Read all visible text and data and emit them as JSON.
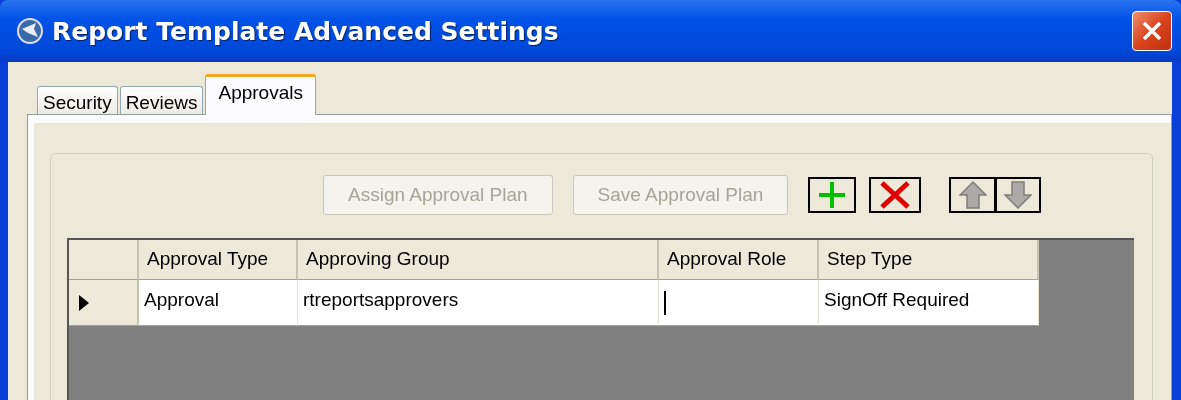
{
  "window": {
    "title": "Report Template Advanced Settings"
  },
  "tabs": [
    {
      "label": "Security",
      "selected": false
    },
    {
      "label": "Reviews",
      "selected": false
    },
    {
      "label": "Approvals",
      "selected": true
    }
  ],
  "toolbar": [
    {
      "kind": "text",
      "label": "Assign Approval Plan",
      "disabled": true
    },
    {
      "kind": "text",
      "label": "Save Approval Plan",
      "disabled": true
    },
    {
      "kind": "add",
      "disabled": false
    },
    {
      "kind": "delete",
      "disabled": false
    },
    {
      "kind": "up",
      "disabled": true
    },
    {
      "kind": "down",
      "disabled": true
    }
  ],
  "table": {
    "columns": [
      "Approval Type",
      "Approving Group",
      "Approval Role",
      "Step Type"
    ],
    "rows": [
      {
        "current": true,
        "cells": [
          {
            "text": "Approval",
            "editing": false
          },
          {
            "text": "rtreportsapprovers",
            "editing": false
          },
          {
            "editing": true
          },
          {
            "text": "SignOff Required",
            "editing": false
          }
        ]
      }
    ]
  }
}
